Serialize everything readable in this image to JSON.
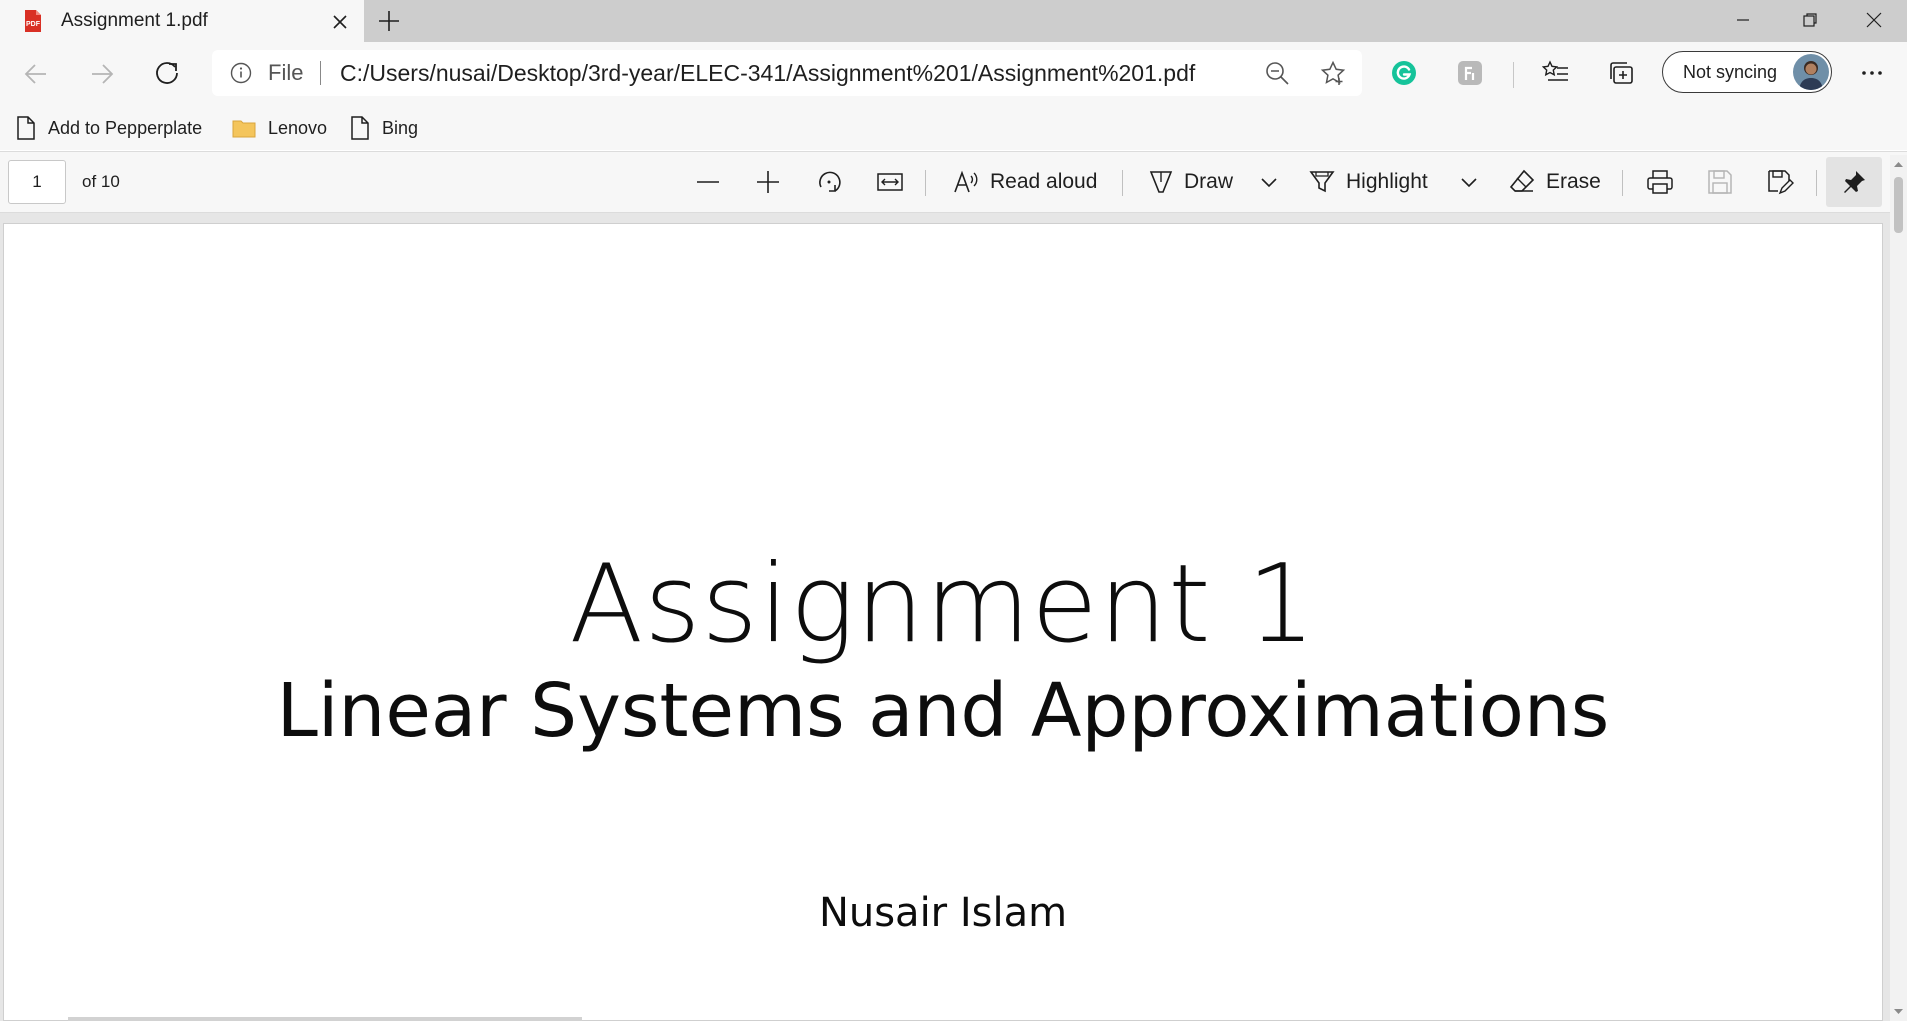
{
  "tab": {
    "title": "Assignment 1.pdf",
    "favicon": "pdf-file-icon"
  },
  "address_bar": {
    "scheme_label": "File",
    "url": "C:/Users/nusai/Desktop/3rd-year/ELEC-341/Assignment%201/Assignment%201.pdf"
  },
  "profile": {
    "sync_label": "Not syncing"
  },
  "favorites": [
    {
      "label": "Add to Pepperplate",
      "icon": "page-icon"
    },
    {
      "label": "Lenovo",
      "icon": "folder-icon"
    },
    {
      "label": "Bing",
      "icon": "page-icon"
    }
  ],
  "pdf_toolbar": {
    "page_current": "1",
    "page_total_label": "of 10",
    "read_aloud_label": "Read aloud",
    "draw_label": "Draw",
    "highlight_label": "Highlight",
    "erase_label": "Erase"
  },
  "document": {
    "title": "Assignment 1",
    "subtitle": "Linear Systems and Approximations",
    "author": "Nusair Islam"
  },
  "colors": {
    "grammarly": "#15c39a",
    "pdf_red": "#d93025"
  }
}
